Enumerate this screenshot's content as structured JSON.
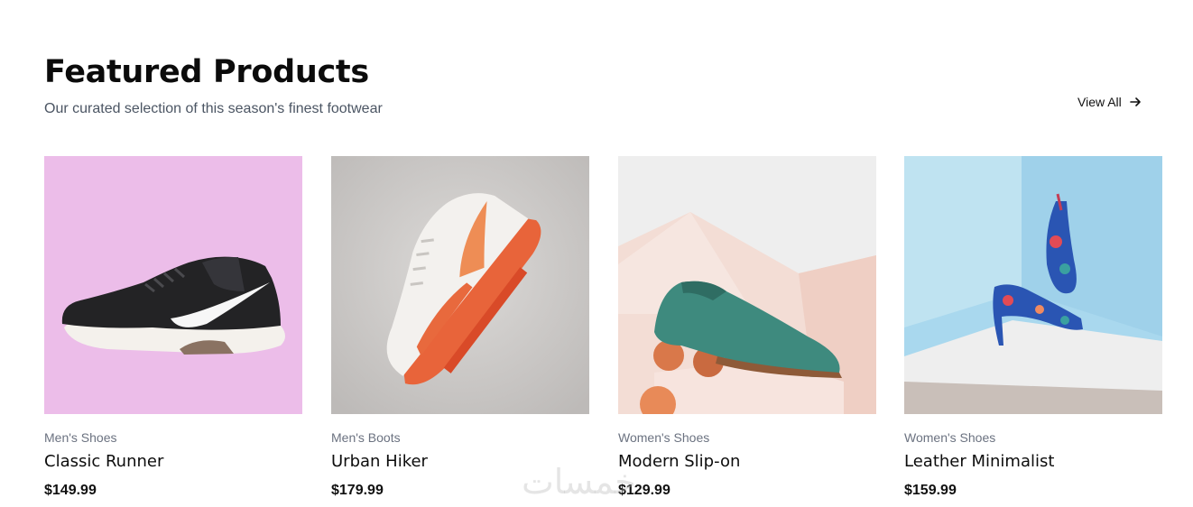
{
  "header": {
    "title": "Featured Products",
    "subtitle": "Our curated selection of this season's finest footwear",
    "view_all_label": "View All",
    "view_all_icon": "arrow-right-icon"
  },
  "products": [
    {
      "category": "Men's Shoes",
      "name": "Classic Runner",
      "price": "$149.99",
      "image": "black-white-sneaker-on-pink"
    },
    {
      "category": "Men's Boots",
      "name": "Urban Hiker",
      "price": "$179.99",
      "image": "orange-white-sneaker-on-grey"
    },
    {
      "category": "Women's Shoes",
      "name": "Modern Slip-on",
      "price": "$129.99",
      "image": "teal-suede-shoe-with-peaches"
    },
    {
      "category": "Women's Shoes",
      "name": "Leather Minimalist",
      "price": "$159.99",
      "image": "floral-heels-on-blue"
    }
  ],
  "watermark": "خمسات",
  "colors": {
    "title": "#0b0b0b",
    "subtitle": "#4b5563",
    "category": "#6b7280",
    "card1_bg": "#ecbde9",
    "card2_bg": "#cfcccb",
    "card3_bg": "#f1e0da",
    "card4_bg": "#a9d8ee"
  }
}
